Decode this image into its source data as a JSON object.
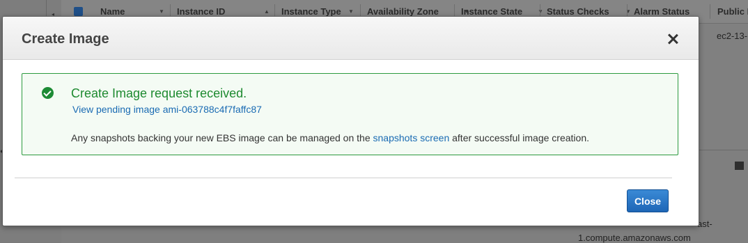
{
  "background_table": {
    "columns": [
      {
        "label": "Name",
        "sort": "▼"
      },
      {
        "label": "Instance ID",
        "sort": "▲"
      },
      {
        "label": "Instance Type",
        "sort": "▼"
      },
      {
        "label": "Availability Zone",
        "sort": "▼"
      },
      {
        "label": "Instance State",
        "sort": "▼"
      },
      {
        "label": "Status Checks",
        "sort": "▼"
      },
      {
        "label": "Alarm Status",
        "sort": ""
      },
      {
        "label": "Public I",
        "sort": ""
      }
    ],
    "public_dns_partial": "ec2-13-",
    "bottom_fragment_1": "ast-",
    "bottom_fragment_2": "1.compute.amazonaws.com"
  },
  "modal": {
    "title": "Create Image",
    "success_title": "Create Image request received.",
    "pending_link": "View pending image ami-063788c4f7faffc87",
    "desc_before": "Any snapshots backing your new EBS image can be managed on the",
    "desc_link": "snapshots screen",
    "desc_after": "after successful image creation.",
    "close_button": "Close"
  },
  "colors": {
    "success_green": "#1e8a30",
    "link_blue": "#1a6bb3",
    "button_blue": "#1e66b6"
  }
}
